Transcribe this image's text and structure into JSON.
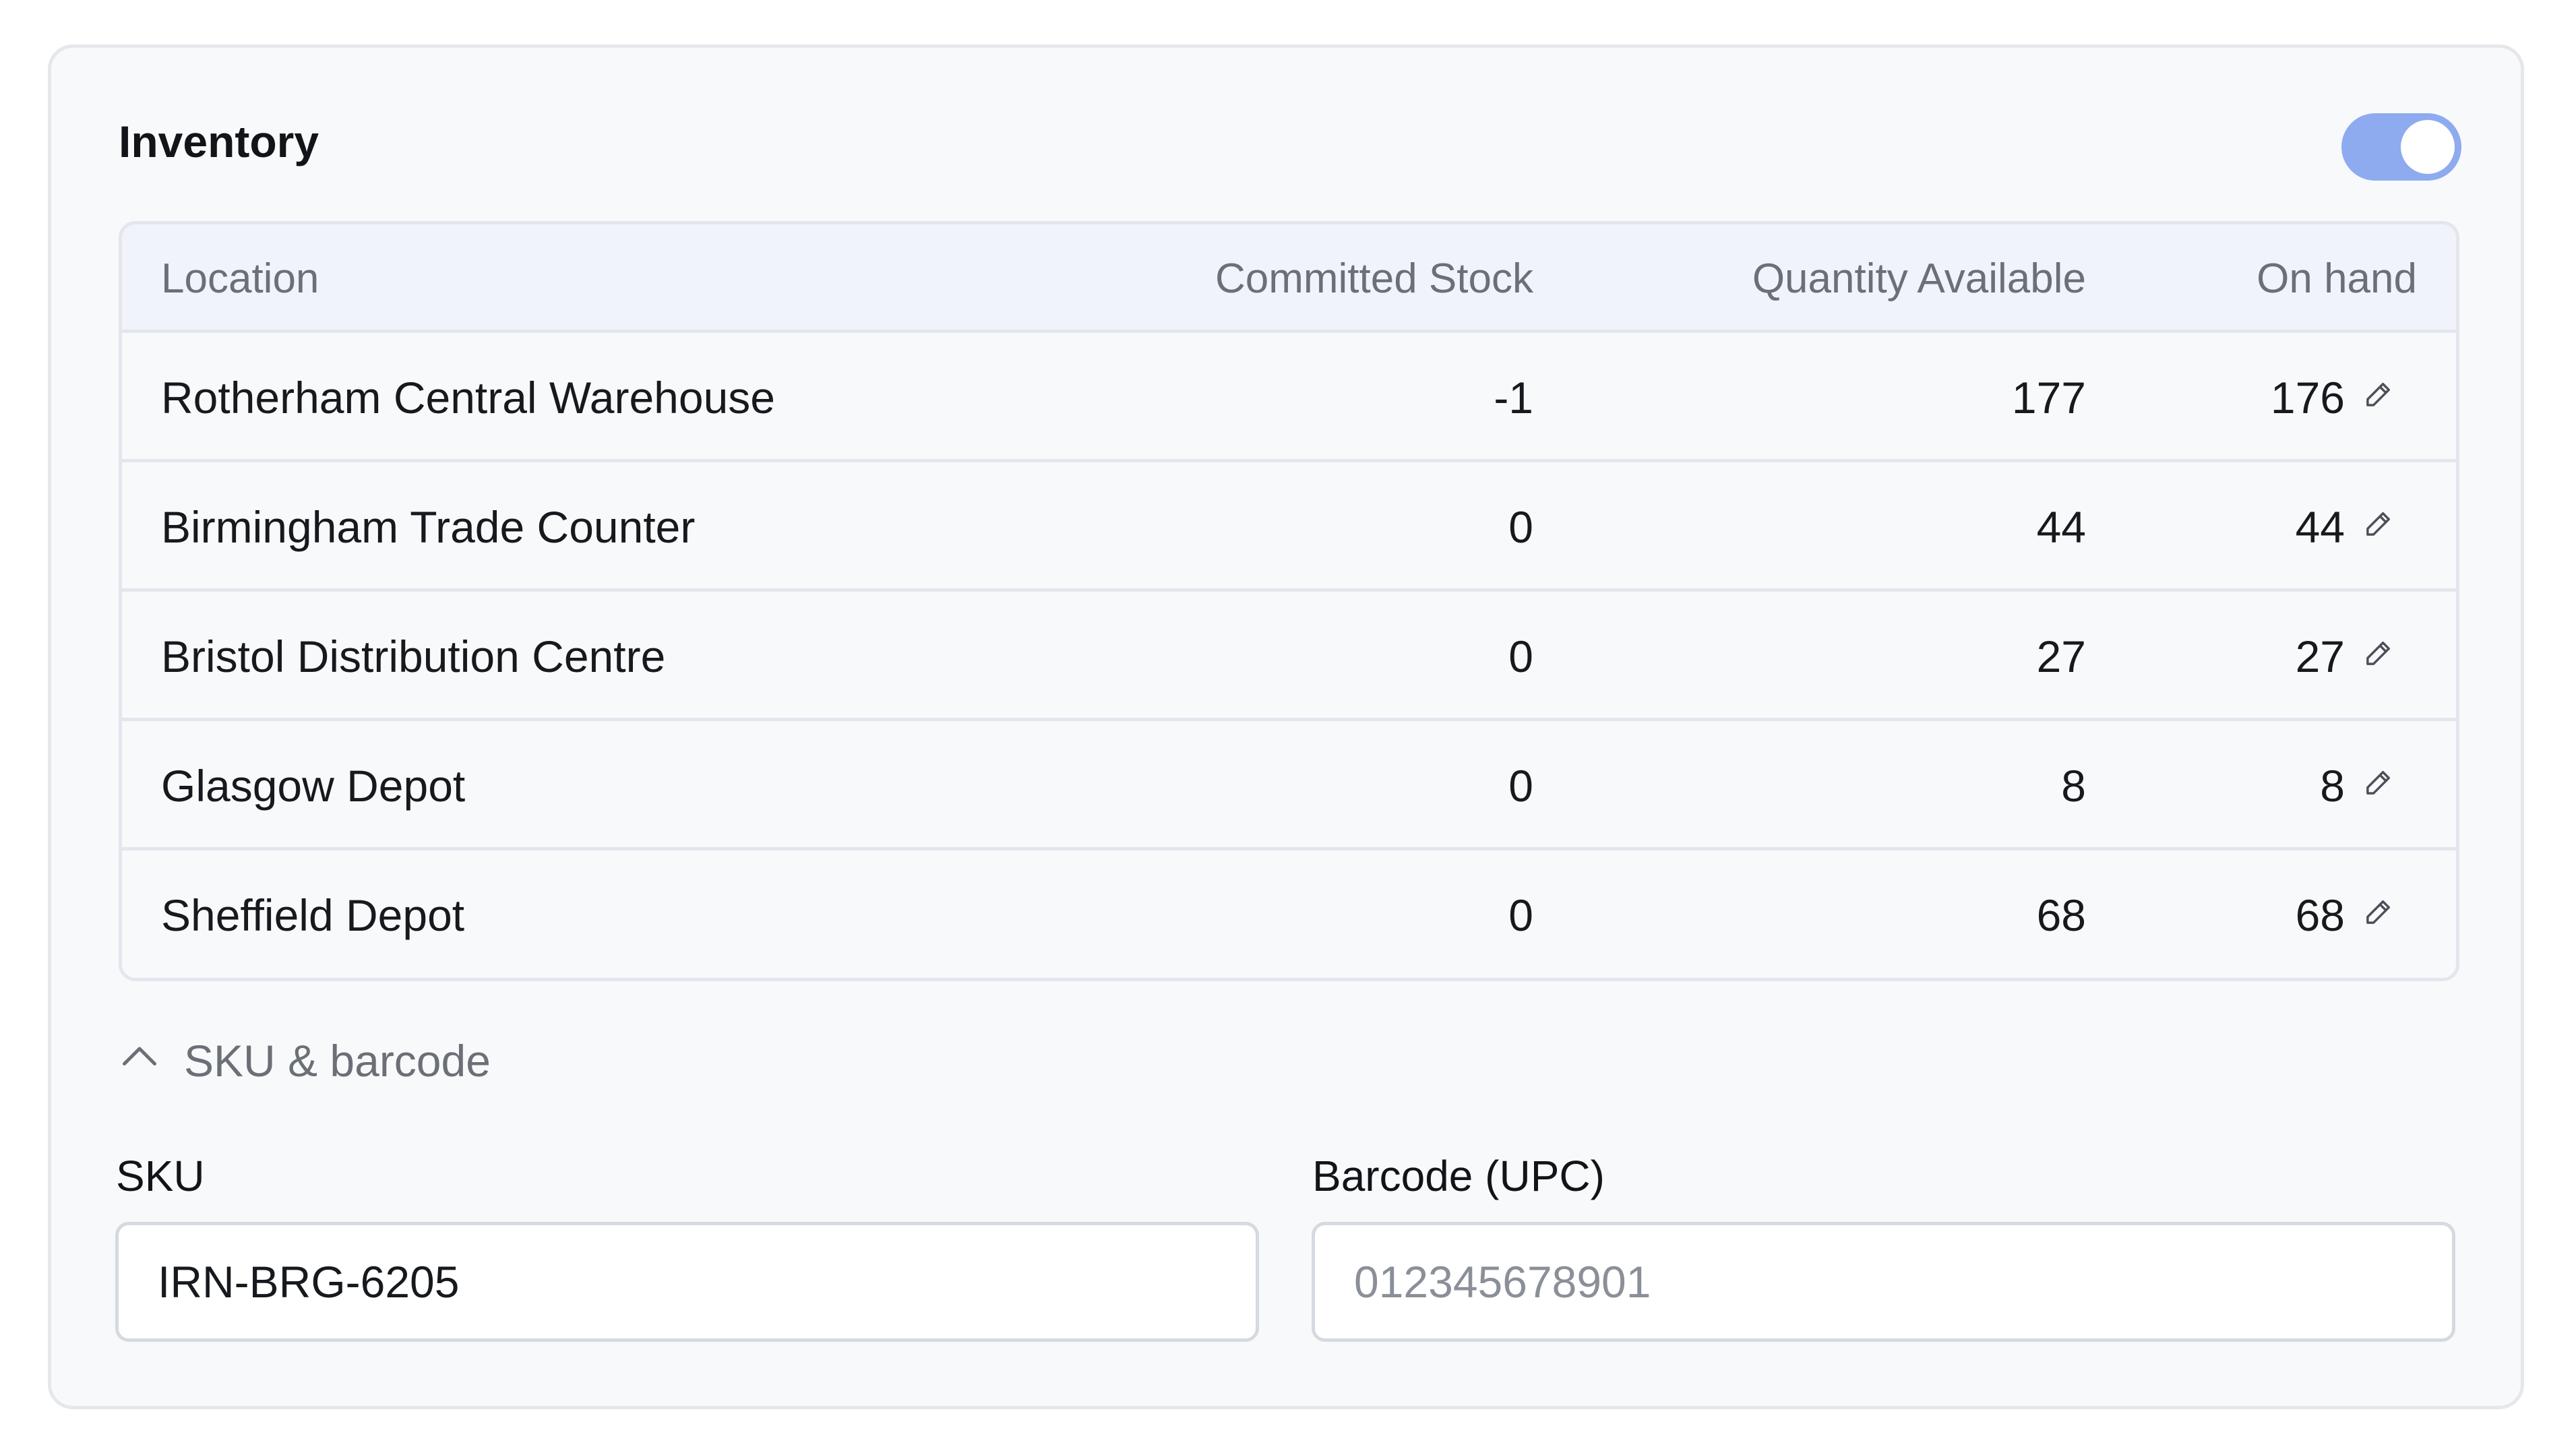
{
  "inventory": {
    "title": "Inventory",
    "toggle": {
      "state": "on",
      "color": "#8eabf0"
    },
    "table": {
      "headers": {
        "location": "Location",
        "committed": "Committed Stock",
        "available": "Quantity Available",
        "on_hand": "On hand"
      },
      "rows": [
        {
          "location": "Rotherham Central Warehouse",
          "committed": "-1",
          "available": "177",
          "on_hand": "176"
        },
        {
          "location": "Birmingham Trade Counter",
          "committed": "0",
          "available": "44",
          "on_hand": "44"
        },
        {
          "location": "Bristol Distribution Centre",
          "committed": "0",
          "available": "27",
          "on_hand": "27"
        },
        {
          "location": "Glasgow Depot",
          "committed": "0",
          "available": "8",
          "on_hand": "8"
        },
        {
          "location": "Sheffield Depot",
          "committed": "0",
          "available": "68",
          "on_hand": "68"
        }
      ],
      "edit_icon": "pencil-icon"
    }
  },
  "sku_section": {
    "toggle_label": "SKU & barcode",
    "toggle_icon": "chevron-up-icon",
    "sku": {
      "label": "SKU",
      "value": "IRN-BRG-6205",
      "placeholder": ""
    },
    "barcode": {
      "label": "Barcode (UPC)",
      "value": "",
      "placeholder": "012345678901"
    }
  }
}
